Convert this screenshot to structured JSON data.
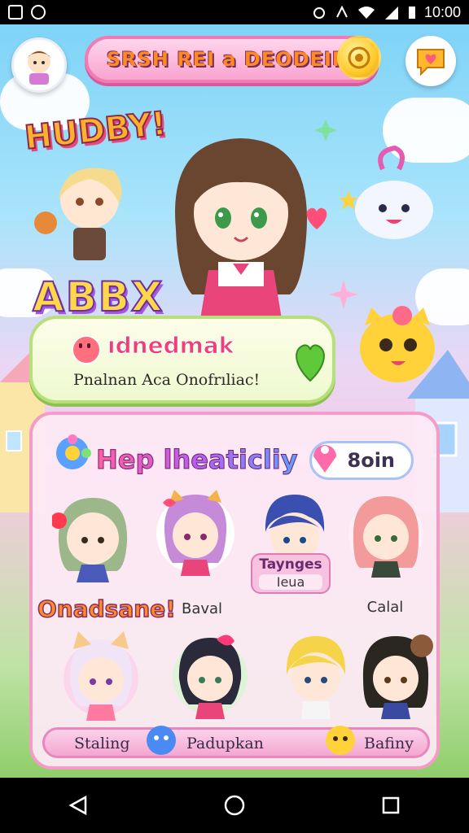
{
  "status_bar": {
    "time": "10:00"
  },
  "header": {
    "title": "SRSH REI a DEODEIR!"
  },
  "hero": {
    "happy_word": "HUDBY!",
    "abbx_word": "ABBX"
  },
  "info_card": {
    "title": "ıdnedmak",
    "subtitle": "Pnalnan Aca Onofrıliac!"
  },
  "panel": {
    "title": "Hep lheaticliy",
    "score": "8oin",
    "characters": [
      {
        "name": "onadsane-char",
        "label": "Onadsane!"
      },
      {
        "name": "baval-char",
        "label": "Baval"
      },
      {
        "name": "taynges-char",
        "label_top": "Taynges",
        "label_bottom": "Ieua"
      },
      {
        "name": "calal-char",
        "label": "Calal"
      },
      {
        "name": "cat-girl-char",
        "label": ""
      },
      {
        "name": "bow-girl-char",
        "label": ""
      },
      {
        "name": "blonde-boy-char",
        "label": ""
      },
      {
        "name": "dark-girl-char",
        "label": ""
      }
    ],
    "bottom_strip": [
      {
        "label": "Staling"
      },
      {
        "label": "Padupkan"
      },
      {
        "label": "Bafiny"
      }
    ]
  },
  "colors": {
    "accent_pink": "#f27ab5",
    "accent_yellow": "#ffc928",
    "accent_green": "#b7e07a"
  },
  "icons": {
    "avatar": "boy-avatar-icon",
    "coin": "coin-icon",
    "menu": "chat-heart-icon",
    "back": "back-triangle-icon",
    "home": "home-circle-icon",
    "recent": "recents-square-icon"
  }
}
